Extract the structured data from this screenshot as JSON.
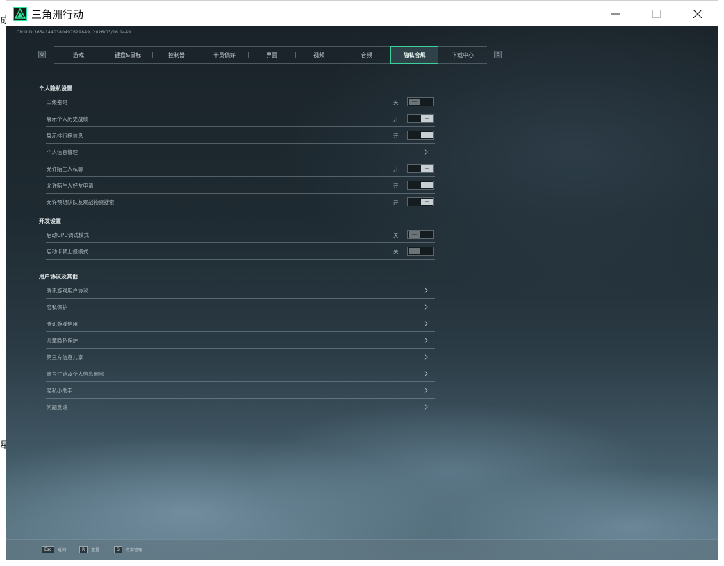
{
  "window": {
    "title": "三角洲行动",
    "controls": [
      "minimize-icon",
      "maximize-icon",
      "close-icon"
    ]
  },
  "desktop_fragments": [
    "成",
    "星"
  ],
  "uid": "CN:UID:365414403804976298​49, 2026/03/16 1449",
  "tabs": {
    "left_key": "Q",
    "right_key": "E",
    "items": [
      {
        "label": "游戏",
        "active": false
      },
      {
        "label": "键盘&鼠标",
        "active": false
      },
      {
        "label": "控制器",
        "active": false
      },
      {
        "label": "干员偏好",
        "active": false
      },
      {
        "label": "界面",
        "active": false
      },
      {
        "label": "视频",
        "active": false
      },
      {
        "label": "音频",
        "active": false
      },
      {
        "label": "隐私合规",
        "active": true
      },
      {
        "label": "下载中心",
        "active": false
      }
    ]
  },
  "sections": [
    {
      "title": "个人隐私设置",
      "rows": [
        {
          "label": "二级密码",
          "type": "toggle",
          "state": "关",
          "on": false
        },
        {
          "label": "展示个人历史战绩",
          "type": "toggle",
          "state": "开",
          "on": true
        },
        {
          "label": "展示排行榜信息",
          "type": "toggle",
          "state": "开",
          "on": true
        },
        {
          "label": "个人信息管理",
          "type": "link"
        },
        {
          "label": "允许陌生人私聊",
          "type": "toggle",
          "state": "开",
          "on": true
        },
        {
          "label": "允许陌生人好友申请",
          "type": "toggle",
          "state": "开",
          "on": true
        },
        {
          "label": "允许预组队队友观战物资搜索",
          "type": "toggle",
          "state": "开",
          "on": true
        }
      ]
    },
    {
      "title": "开发设置",
      "rows": [
        {
          "label": "启动GPU调试模式",
          "type": "toggle",
          "state": "关",
          "on": false
        },
        {
          "label": "启动卡顿上报模式",
          "type": "toggle",
          "state": "关",
          "on": false
        }
      ]
    },
    {
      "title": "用户协议及其他",
      "rows": [
        {
          "label": "腾讯游戏用户协议",
          "type": "link"
        },
        {
          "label": "隐私保护",
          "type": "link"
        },
        {
          "label": "腾讯游戏信用",
          "type": "link"
        },
        {
          "label": "儿童隐私保护",
          "type": "link"
        },
        {
          "label": "第三方信息共享",
          "type": "link"
        },
        {
          "label": "账号注销及个人信息删除",
          "type": "link"
        },
        {
          "label": "隐私小助手",
          "type": "link"
        },
        {
          "label": "问题反馈",
          "type": "link"
        }
      ]
    }
  ],
  "bottom_hints": [
    {
      "key": "Esc",
      "label": "返回"
    },
    {
      "key": "R",
      "label": "重置"
    },
    {
      "key": "S",
      "label": "方案管理"
    }
  ],
  "colors": {
    "accent": "#3ad19a",
    "background": "#1e2a31"
  }
}
